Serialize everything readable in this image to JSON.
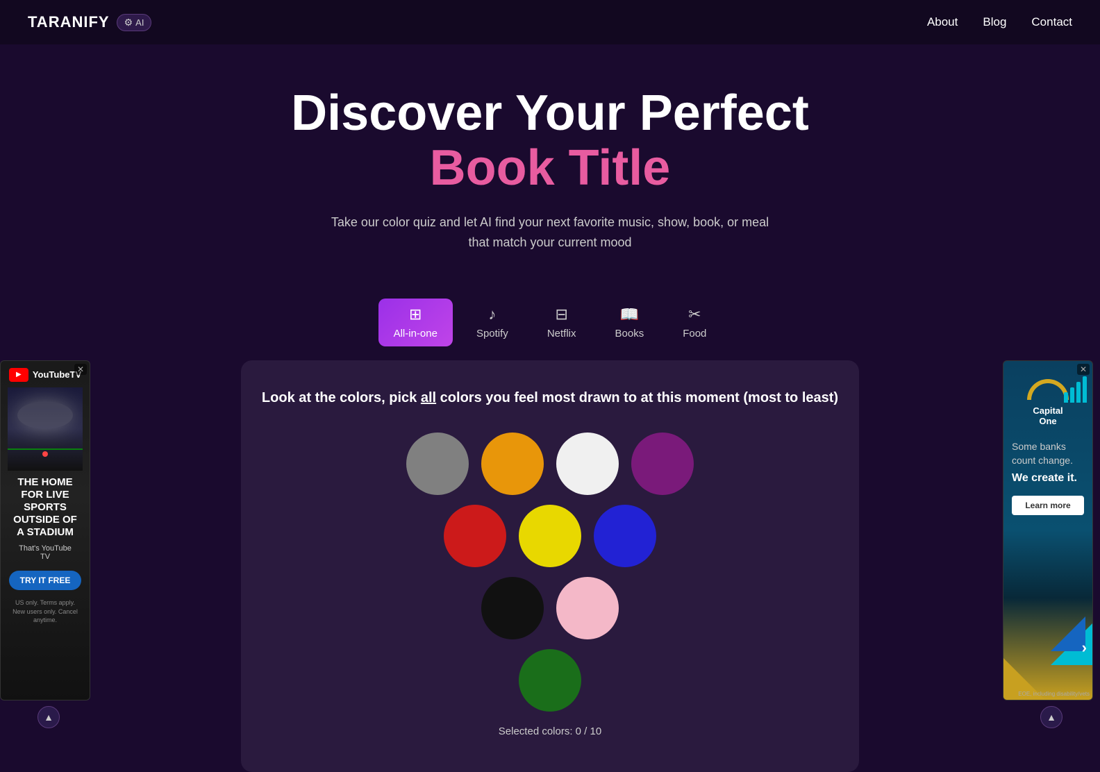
{
  "brand": {
    "name": "TARANIFY",
    "ai_label": "AI"
  },
  "navbar": {
    "links": [
      {
        "label": "About",
        "href": "#"
      },
      {
        "label": "Blog",
        "href": "#"
      },
      {
        "label": "Contact",
        "href": "#"
      }
    ]
  },
  "hero": {
    "title_white": "Discover Your Perfect",
    "title_pink": "Book Title",
    "subtitle_line1": "Take our color quiz and let AI find your next favorite music, show, book, or meal",
    "subtitle_line2": "that match your current mood"
  },
  "tabs": [
    {
      "id": "all-in-one",
      "label": "All-in-one",
      "icon": "⊞",
      "active": true
    },
    {
      "id": "spotify",
      "label": "Spotify",
      "icon": "♪",
      "active": false
    },
    {
      "id": "netflix",
      "label": "Netflix",
      "icon": "⊟",
      "active": false
    },
    {
      "id": "books",
      "label": "Books",
      "icon": "📖",
      "active": false
    },
    {
      "id": "food",
      "label": "Food",
      "icon": "✂",
      "active": false
    }
  ],
  "quiz": {
    "instruction_before": "Look at the colors, pick ",
    "instruction_underline": "all",
    "instruction_after": " colors you feel most drawn to at this moment (most to least)",
    "colors": [
      {
        "id": "gray",
        "hex": "#808080",
        "row": 1
      },
      {
        "id": "orange",
        "hex": "#e8960a",
        "row": 1
      },
      {
        "id": "white",
        "hex": "#f0f0f0",
        "row": 1
      },
      {
        "id": "purple",
        "hex": "#7a1a7a",
        "row": 1
      },
      {
        "id": "red",
        "hex": "#cc1a1a",
        "row": 2
      },
      {
        "id": "yellow",
        "hex": "#e8d800",
        "row": 2
      },
      {
        "id": "blue",
        "hex": "#2222d4",
        "row": 2
      },
      {
        "id": "black",
        "hex": "#111111",
        "row": 3
      },
      {
        "id": "pink",
        "hex": "#f4b8c8",
        "row": 3
      },
      {
        "id": "green",
        "hex": "#1a6e1a",
        "row": 4
      }
    ],
    "selected_count_label": "Selected colors: 0 / 10"
  },
  "ad_left": {
    "logo_text": "YouTubeTV",
    "tagline": "THE HOME FOR LIVE SPORTS OUTSIDE OF A STADIUM",
    "sub": "That's YouTube TV",
    "button": "TRY IT FREE",
    "disclaimer": "US only. Terms apply.\nNew users only. Cancel anytime."
  },
  "ad_right": {
    "logo": "Capital One",
    "tagline": "Some banks count change.",
    "tagline_bold": "We create it.",
    "button": "Learn more",
    "disclaimer": "EOE, including disability/vets"
  }
}
